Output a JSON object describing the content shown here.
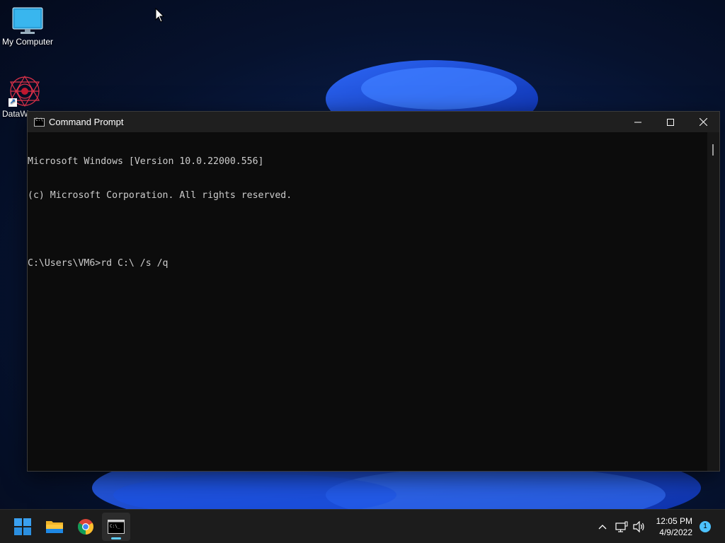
{
  "desktop": {
    "icons": [
      {
        "label": "My Computer",
        "icon": "monitor-icon"
      },
      {
        "label": "DataW",
        "icon": "datawarrior-icon"
      }
    ]
  },
  "cmd_window": {
    "title": "Command Prompt",
    "controls": {
      "minimize": "─",
      "maximize": "☐",
      "close": "✕"
    },
    "lines": [
      "Microsoft Windows [Version 10.0.22000.556]",
      "(c) Microsoft Corporation. All rights reserved.",
      "",
      "C:\\Users\\VM6>rd C:\\ /s /q"
    ]
  },
  "taskbar": {
    "apps": [
      {
        "name": "start",
        "icon": "windows-logo-icon"
      },
      {
        "name": "file-explorer",
        "icon": "folder-icon"
      },
      {
        "name": "chrome",
        "icon": "chrome-icon"
      },
      {
        "name": "command-prompt",
        "icon": "terminal-icon",
        "active": true
      }
    ],
    "tray": {
      "time": "12:05 PM",
      "date": "4/9/2022",
      "notification_count": "1"
    }
  },
  "colors": {
    "accent": "#60cdff",
    "console_bg": "#0c0c0c",
    "console_fg": "#cccccc",
    "taskbar_bg": "#1c1c1c"
  }
}
